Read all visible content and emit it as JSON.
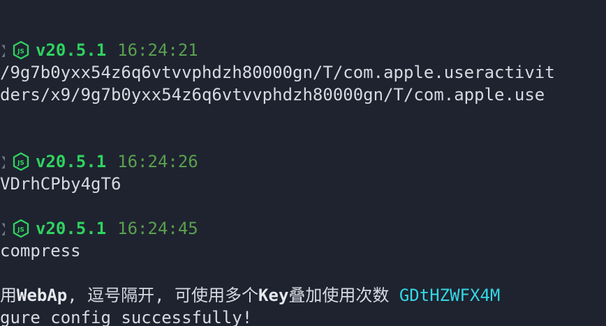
{
  "colors": {
    "background": "#1f2330",
    "text": "#d7dae0",
    "node_version": "#2fd35f",
    "timestamp": "#5aa04e",
    "key": "#35d7e5"
  },
  "prompts": [
    {
      "icon": "nodejs-icon",
      "version": "v20.5.1",
      "time": "16:24:21"
    },
    {
      "icon": "nodejs-icon",
      "version": "v20.5.1",
      "time": "16:24:26"
    },
    {
      "icon": "nodejs-icon",
      "version": "v20.5.1",
      "time": "16:24:45"
    }
  ],
  "output": {
    "path_line_1": "/9g7b0yxx54z6q6vtvvphdzh80000gn/T/com.apple.useractivit",
    "path_line_2": "ders/x9/9g7b0yxx54z6q6vtvvphdzh80000gn/T/com.apple.use",
    "token_line": "VDrhCPby4gT6",
    "compress_line": "compress",
    "cn_part_1": "用",
    "cn_bold_1": "WebAp",
    "cn_part_2": ", 逗号隔开, 可使用多个",
    "cn_bold_2": "Key",
    "cn_part_3": "叠加使用次数 ",
    "cn_key": "GDtHZWFX4M",
    "success_line": "gure config successfully!"
  }
}
